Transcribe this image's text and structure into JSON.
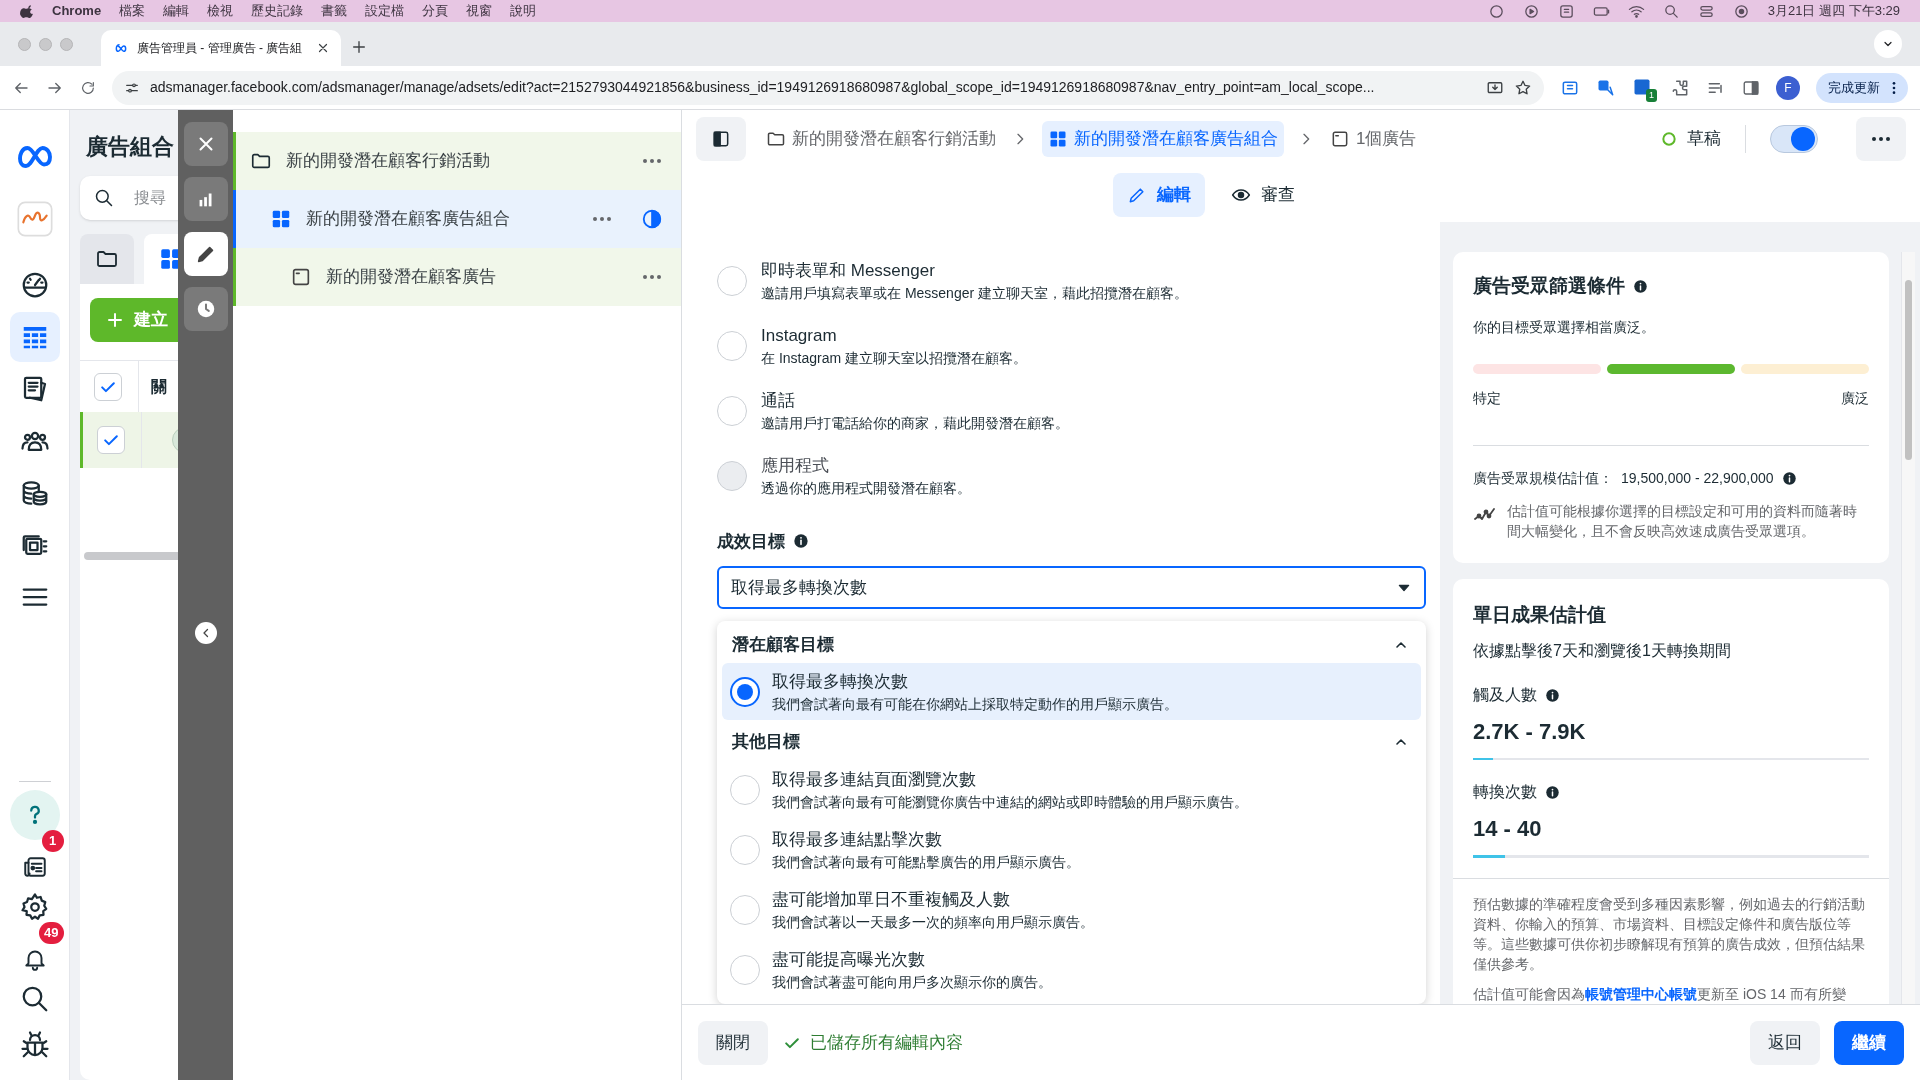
{
  "menu_bar": {
    "app": "Chrome",
    "menus": [
      "檔案",
      "編輯",
      "檢視",
      "歷史記錄",
      "書籤",
      "設定檔",
      "分頁",
      "視窗",
      "說明"
    ],
    "clock": "3月21日 週四 下午3:29"
  },
  "browser": {
    "tab": {
      "title": "廣告管理員 - 管理廣告 - 廣告組",
      "selected": true
    },
    "url": "adsmanager.facebook.com/adsmanager/manage/adsets/edit?act=2152793044921856&business_id=1949126918680987&global_scope_id=1949126918680987&nav_entry_point=am_local_scope...",
    "extension_badge": "1",
    "profile": "F",
    "update_button": "完成更新"
  },
  "nav_rail": {
    "top": [
      {
        "kind": "meta",
        "selected": false
      },
      {
        "kind": "account",
        "selected": false
      },
      {
        "kind": "dashboard",
        "selected": false
      },
      {
        "kind": "campaigns",
        "selected": true
      },
      {
        "kind": "pages",
        "selected": false
      },
      {
        "kind": "audiences",
        "selected": false
      },
      {
        "kind": "billing",
        "selected": false
      },
      {
        "kind": "catalog",
        "selected": false
      },
      {
        "kind": "menu",
        "selected": false
      }
    ],
    "bottom": [
      {
        "kind": "help",
        "selected": false
      },
      {
        "kind": "news",
        "selected": false,
        "badge": "1"
      },
      {
        "kind": "settings",
        "selected": false
      },
      {
        "kind": "notifications",
        "selected": false,
        "badge": "49"
      },
      {
        "kind": "search",
        "selected": false
      },
      {
        "kind": "bug",
        "selected": false
      }
    ]
  },
  "campaign_panel": {
    "title": "廣告組合",
    "search_placeholder": "搜尋",
    "create_button": "建立",
    "column_1": "關",
    "checkboxes": [
      {
        "checked": true
      },
      {
        "checked": true
      }
    ]
  },
  "tool_strip": [
    {
      "kind": "close",
      "selected": false
    },
    {
      "kind": "chart",
      "selected": false
    },
    {
      "kind": "edit",
      "selected": true
    },
    {
      "kind": "history",
      "selected": false
    }
  ],
  "tree": [
    {
      "kind": "campaign",
      "label": "新的開發潛在顧客行銷活動",
      "selected": false,
      "children": [
        {
          "kind": "adset",
          "label": "新的開發潛在顧客廣告組合",
          "selected": true,
          "children": [
            {
              "kind": "ad",
              "label": "新的開發潛在顧客廣告",
              "selected": false
            }
          ]
        }
      ]
    }
  ],
  "breadcrumb": [
    {
      "kind": "campaign",
      "label": "新的開發潛在顧客行銷活動",
      "selected": false
    },
    {
      "kind": "adset",
      "label": "新的開發潛在顧客廣告組合",
      "selected": true
    },
    {
      "kind": "ad",
      "label": "1個廣告",
      "selected": false
    }
  ],
  "status": {
    "label": "草稿",
    "on": true
  },
  "view_tabs": [
    {
      "kind": "edit",
      "label": "編輯",
      "selected": true
    },
    {
      "kind": "review",
      "label": "審查",
      "selected": false
    }
  ],
  "conversion_locations": [
    {
      "title": "即時表單和 Messenger",
      "description": "邀請用戶填寫表單或在 Messenger 建立聊天室，藉此招攬潛在顧客。",
      "selected": false,
      "disabled": false
    },
    {
      "title": "Instagram",
      "description": "在 Instagram 建立聊天室以招攬潛在顧客。",
      "selected": false,
      "disabled": false
    },
    {
      "title": "通話",
      "description": "邀請用戶打電話給你的商家，藉此開發潛在顧客。",
      "selected": false,
      "disabled": false
    },
    {
      "title": "應用程式",
      "description": "透過你的應用程式開發潛在顧客。",
      "selected": false,
      "disabled": true
    }
  ],
  "performance_goal": {
    "label": "成效目標",
    "value": "取得最多轉換次數",
    "menu": [
      {
        "title": "潛在顧客目標",
        "expanded": true,
        "options": [
          {
            "title": "取得最多轉換次數",
            "description": "我們會試著向最有可能在你網站上採取特定動作的用戶顯示廣告。",
            "selected": true
          }
        ]
      },
      {
        "title": "其他目標",
        "expanded": true,
        "options": [
          {
            "title": "取得最多連結頁面瀏覽次數",
            "description": "我們會試著向最有可能瀏覽你廣告中連結的網站或即時體驗的用戶顯示廣告。",
            "selected": false
          },
          {
            "title": "取得最多連結點擊次數",
            "description": "我們會試著向最有可能點擊廣告的用戶顯示廣告。",
            "selected": false
          },
          {
            "title": "盡可能增加單日不重複觸及人數",
            "description": "我們會試著以一天最多一次的頻率向用戶顯示廣告。",
            "selected": false
          },
          {
            "title": "盡可能提高曝光次數",
            "description": "我們會試著盡可能向用戶多次顯示你的廣告。",
            "selected": false
          }
        ]
      }
    ]
  },
  "audience_card": {
    "title": "廣告受眾篩選條件",
    "summary": "你的目標受眾選擇相當廣泛。",
    "meter": [
      {
        "color": "#fde4e4"
      },
      {
        "color": "#5cb82f"
      },
      {
        "color": "#fdefd3"
      }
    ],
    "left_label": "特定",
    "right_label": "廣泛",
    "size_label": "廣告受眾規模估計值：",
    "size_value": "19,500,000 - 22,900,000",
    "note": "估計值可能根據你選擇的目標設定和可用的資料而隨著時間大幅變化，且不會反映高效速成廣告受眾選項。"
  },
  "results_card": {
    "title": "單日成果估計值",
    "subtitle": "依據點擊後7天和瀏覽後1天轉換期間",
    "metrics": [
      {
        "label": "觸及人數",
        "value": "2.7K - 7.9K",
        "level": 0.05
      },
      {
        "label": "轉換次數",
        "value": "14 - 40",
        "level": 0.08
      }
    ],
    "disclaimer": "預估數據的準確程度會受到多種因素影響，例如過去的行銷活動資料、你輸入的預算、市場資料、目標設定條件和廣告版位等等。這些數據可供你初步瞭解現有預算的廣告成效，但預估結果僅供參考。",
    "footnote_before": "估計值可能會因為",
    "footnote_link": "帳號管理中心帳號",
    "footnote_after": "更新至 iOS 14 而有所變"
  },
  "footer": {
    "close_button": "關閉",
    "saved_status": "已儲存所有編輯內容",
    "back_button": "返回",
    "continue_button": "繼續"
  }
}
